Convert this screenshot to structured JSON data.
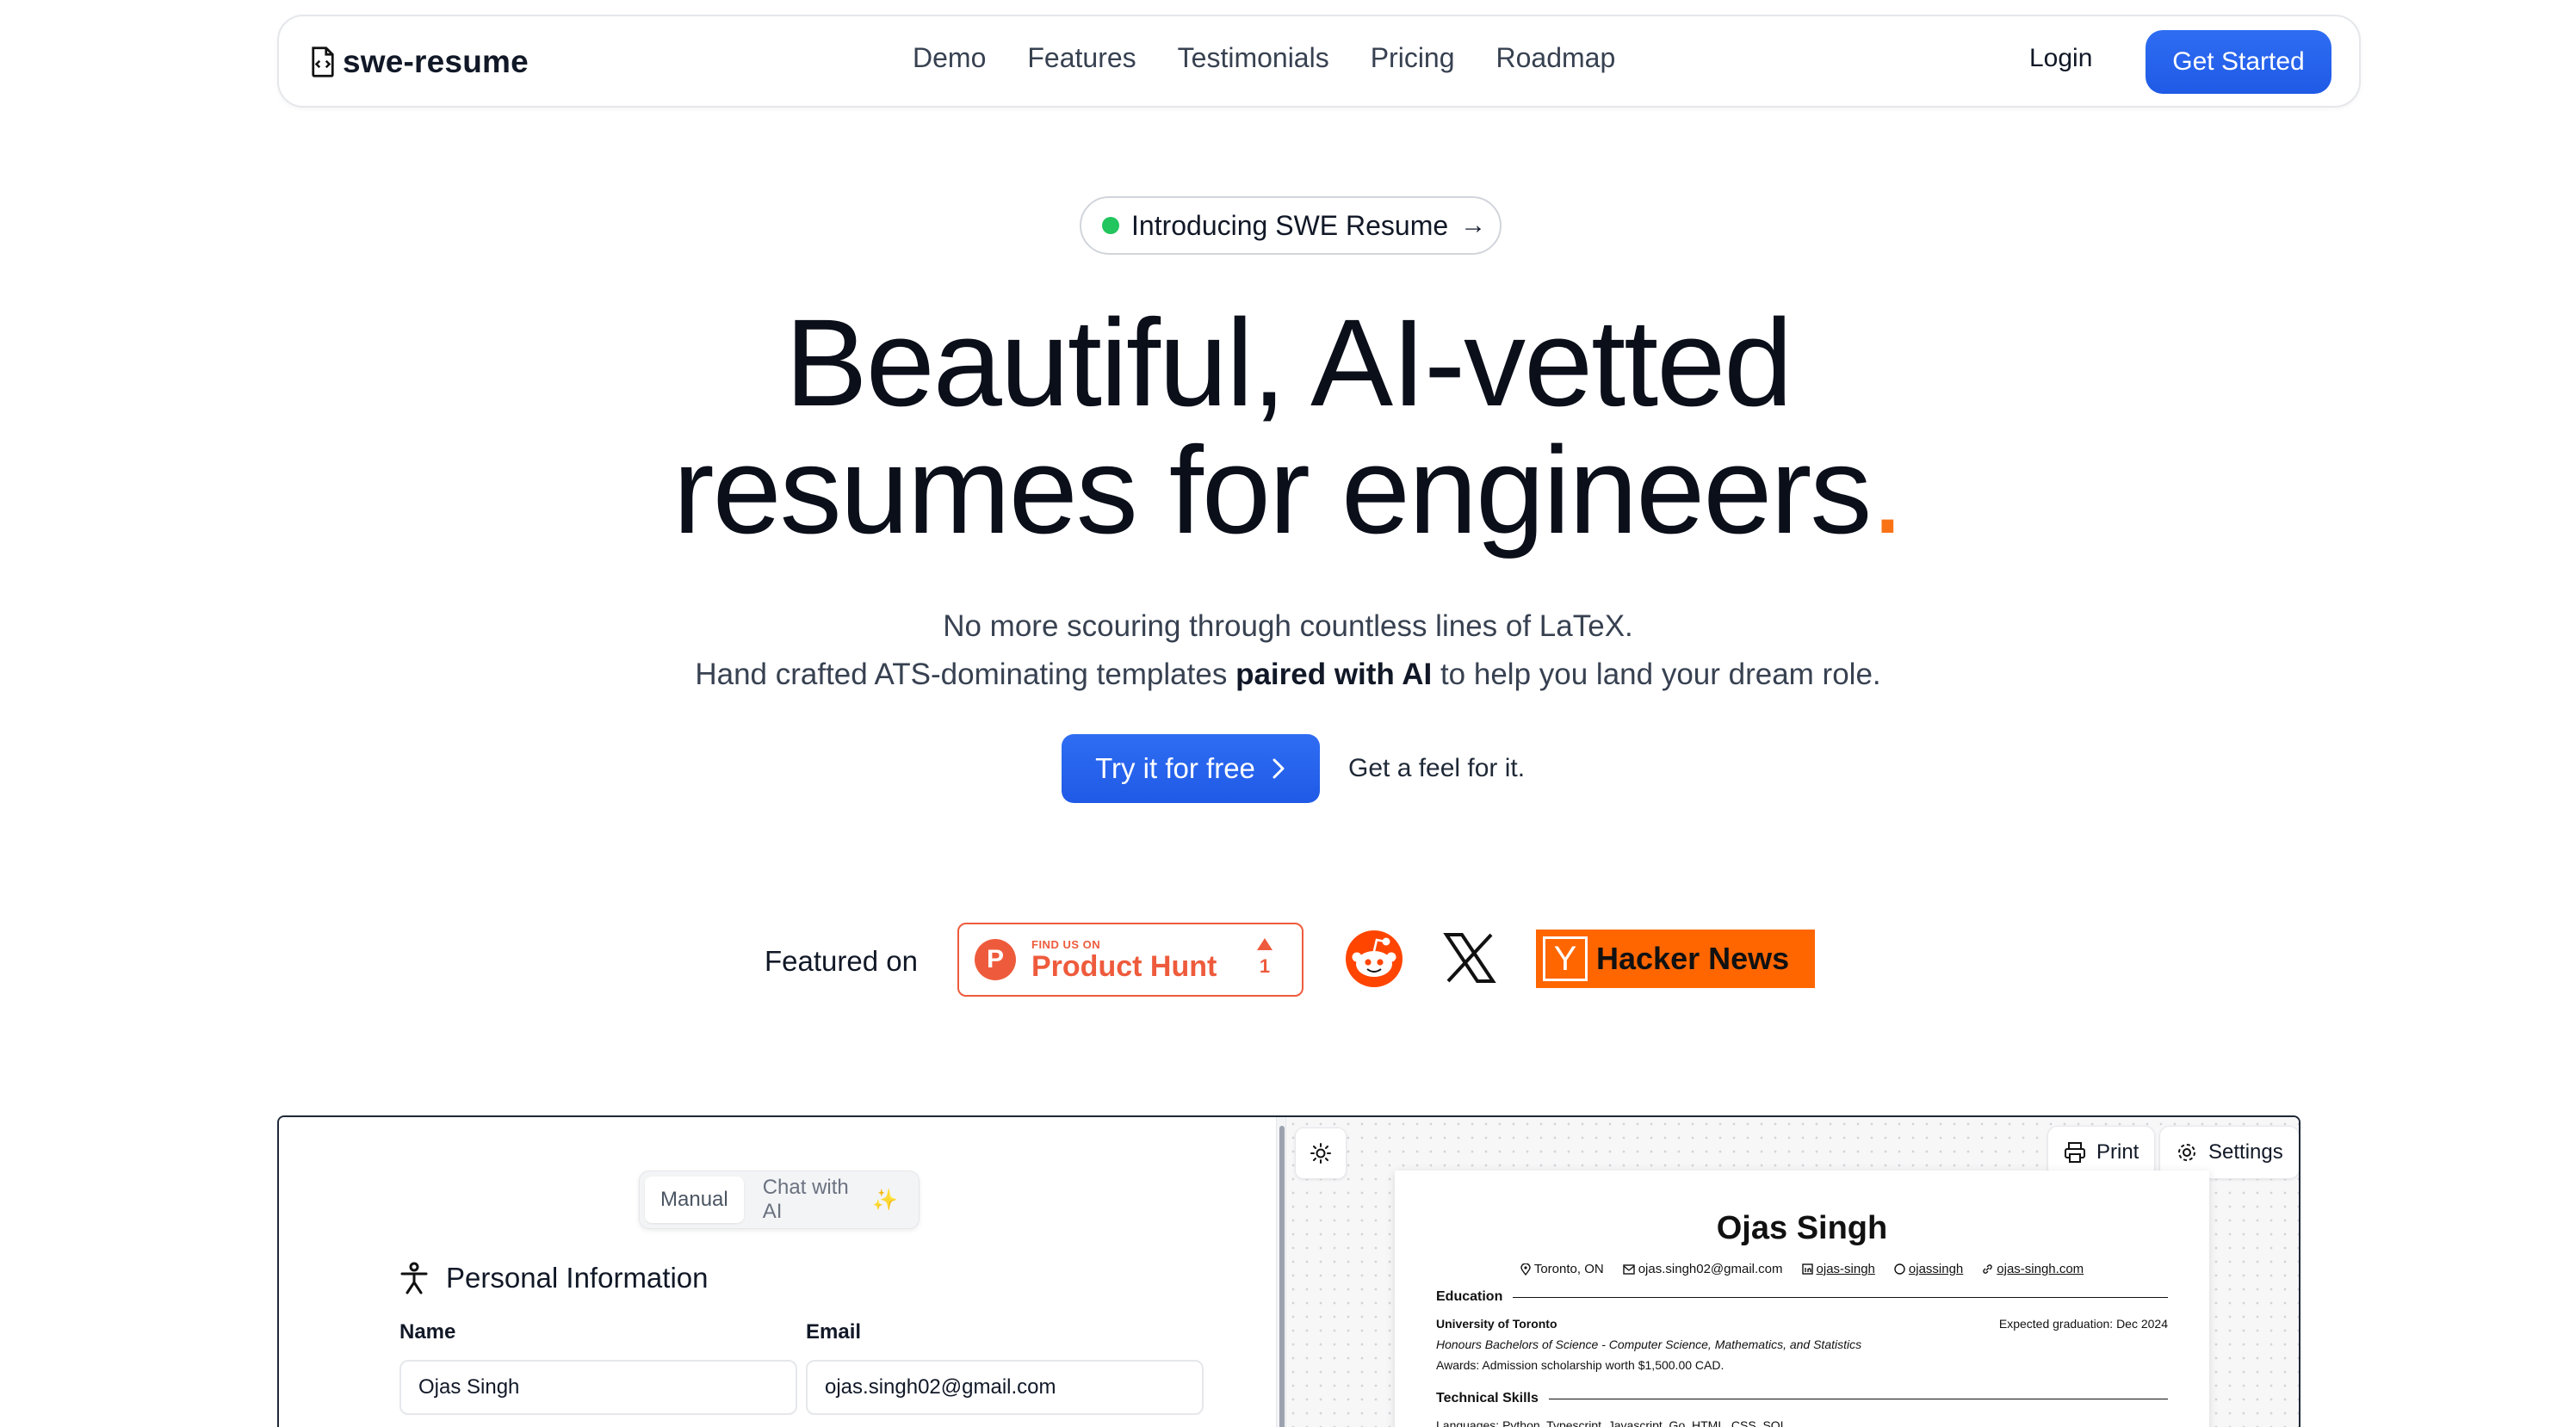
{
  "nav": {
    "brand": "swe-resume",
    "links": [
      "Demo",
      "Features",
      "Testimonials",
      "Pricing",
      "Roadmap"
    ],
    "login": "Login",
    "cta": "Get Started"
  },
  "hero": {
    "badge": "Introducing SWE Resume",
    "headline_line1": "Beautiful, AI-vetted",
    "headline_line2": "resumes for engineers",
    "headline_dot": ".",
    "sub_line1": "No more scouring through countless lines of LaTeX.",
    "sub_line2_pre": "Hand crafted ATS-dominating templates ",
    "sub_line2_bold": "paired with AI",
    "sub_line2_post": " to help you land your dream role.",
    "primary_cta": "Try it for free",
    "secondary_cta": "Get a feel for it."
  },
  "featured": {
    "label": "Featured on",
    "product_hunt": {
      "small": "FIND US ON",
      "big": "Product Hunt",
      "votes": "1"
    },
    "hacker_news": {
      "letter": "Y",
      "label": "Hacker News"
    }
  },
  "editor": {
    "tabs": [
      "Manual",
      "Chat with AI"
    ],
    "section_title": "Personal Information",
    "fields": [
      {
        "label": "Name",
        "value": "Ojas Singh"
      },
      {
        "label": "Email",
        "value": "ojas.singh02@gmail.com"
      }
    ],
    "toolbar": {
      "print": "Print",
      "settings": "Settings"
    }
  },
  "resume": {
    "name": "Ojas Singh",
    "contacts": {
      "location": "Toronto, ON",
      "email": "ojas.singh02@gmail.com",
      "linkedin": "ojas-singh",
      "github": "ojassingh",
      "website": "ojas-singh.com"
    },
    "education": {
      "heading": "Education",
      "school": "University of Toronto",
      "graduation": "Expected graduation: Dec 2024",
      "degree": "Honours Bachelors of Science - Computer Science, Mathematics, and Statistics",
      "awards": "Awards: Admission scholarship worth $1,500.00 CAD."
    },
    "skills": {
      "heading": "Technical Skills",
      "languages": "Languages: Python, Typescript, Javascript, Go, HTML, CSS, SQL"
    }
  },
  "colors": {
    "accent_blue": "#2563eb",
    "headline_dot": "#f97316",
    "badge_dot": "#22c55e",
    "product_hunt": "#ee5b3c",
    "hacker_news": "#ff6600",
    "reddit": "#ff4500"
  }
}
